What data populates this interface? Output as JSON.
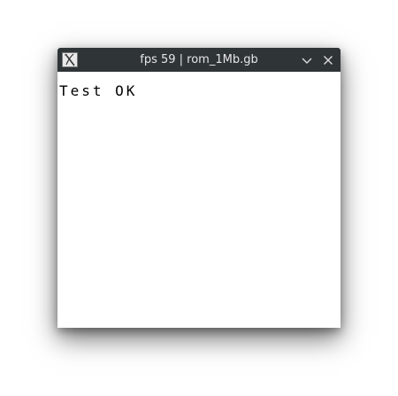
{
  "window": {
    "title": "fps 59 | rom_1Mb.gb",
    "icon": "x-app-icon",
    "controls": {
      "minimize_icon": "chevron-down-icon",
      "close_icon": "close-icon"
    }
  },
  "screen": {
    "text": "Test OK"
  },
  "colors": {
    "titlebar": "#2f3437",
    "title_text": "#e6e6e6",
    "screen_bg": "#ffffff",
    "screen_text": "#000000"
  }
}
